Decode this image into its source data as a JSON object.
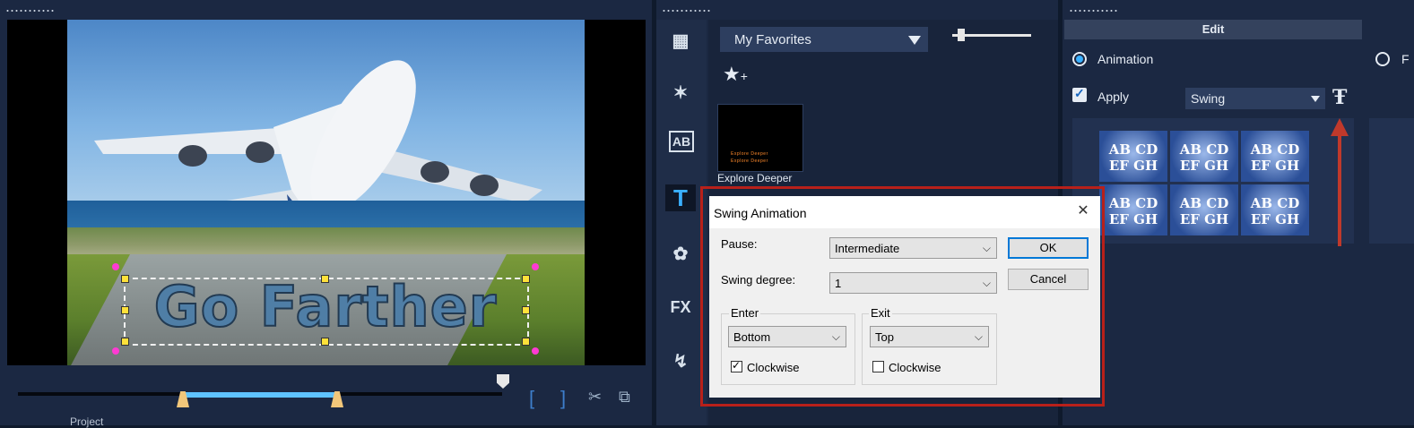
{
  "preview": {
    "title_overlay": "Go Farther",
    "project_label": "Project",
    "bracket_in": "[",
    "bracket_out": "]"
  },
  "library": {
    "category_dropdown": "My Favorites",
    "thumbnail_caption": "Explore Deeper",
    "thumbnail_lines": [
      "Explore Deeper",
      "Explore Deeper"
    ],
    "side_tools": [
      "media-icon",
      "instant-project-icon",
      "transition-icon",
      "title-icon",
      "graphics-icon",
      "filter-icon",
      "path-icon"
    ],
    "side_labels": {
      "transition": "AB",
      "title": "T",
      "filter": "FX"
    }
  },
  "edit": {
    "header": "Edit",
    "animation_label": "Animation",
    "apply_label": "Apply",
    "animation_type": "Swing",
    "presets": [
      {
        "text": "AB CD EF GH"
      },
      {
        "text": "AB CD EF GH"
      },
      {
        "text": "AB CD EF GH"
      },
      {
        "text": "AB CD EF GH"
      },
      {
        "text": "AB CD EF GH"
      },
      {
        "text": "AB CD EF GH"
      }
    ],
    "r_label": "F"
  },
  "dialog": {
    "title": "Swing Animation",
    "close_symbol": "✕",
    "pause_label": "Pause:",
    "pause_value": "Intermediate",
    "swing_degree_label": "Swing degree:",
    "swing_degree_value": "1",
    "enter_label": "Enter",
    "enter_value": "Bottom",
    "enter_clockwise_label": "Clockwise",
    "enter_clockwise_checked": true,
    "exit_label": "Exit",
    "exit_value": "Top",
    "exit_clockwise_label": "Clockwise",
    "exit_clockwise_checked": false,
    "ok_label": "OK",
    "cancel_label": "Cancel"
  },
  "colors": {
    "accent": "#3ab0ff",
    "highlight_frame": "#b8201a",
    "trim_bar": "#5fc3ff"
  }
}
